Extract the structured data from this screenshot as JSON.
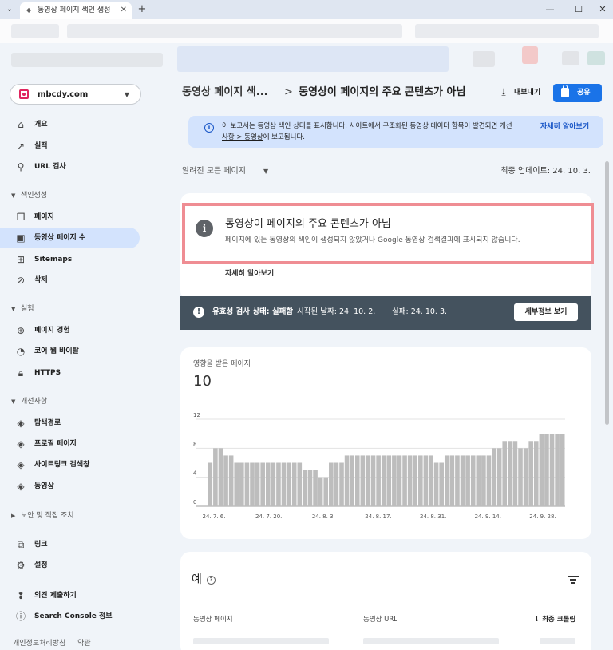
{
  "browser": {
    "tab_title": "동영상 페이지 색인 생성",
    "tab_close": "✕",
    "new_tab": "+",
    "minimize": "—",
    "maximize": "☐",
    "close": "✕"
  },
  "sidebar": {
    "property": "mbcdy.com",
    "items_top": [
      {
        "label": "개요",
        "icon": "home-icon"
      },
      {
        "label": "실적",
        "icon": "trending-up-icon"
      },
      {
        "label": "URL 검사",
        "icon": "search-icon"
      }
    ],
    "sections": [
      {
        "title": "색인생성",
        "items": [
          {
            "label": "페이지",
            "icon": "pages-icon"
          },
          {
            "label": "동영상 페이지 수",
            "icon": "video-pages-icon",
            "active": true
          },
          {
            "label": "Sitemaps",
            "icon": "sitemap-icon"
          },
          {
            "label": "삭제",
            "icon": "removal-icon"
          }
        ]
      },
      {
        "title": "실험",
        "items": [
          {
            "label": "페이지 경험",
            "icon": "page-experience-icon"
          },
          {
            "label": "코어 웹 바이탈",
            "icon": "gauge-icon"
          },
          {
            "label": "HTTPS",
            "icon": "lock-icon"
          }
        ]
      },
      {
        "title": "개선사항",
        "items": [
          {
            "label": "탐색경로",
            "icon": "layers-icon"
          },
          {
            "label": "프로필 페이지",
            "icon": "layers-icon"
          },
          {
            "label": "사이트링크 검색창",
            "icon": "layers-icon"
          },
          {
            "label": "동영상",
            "icon": "layers-icon"
          }
        ]
      }
    ],
    "security_section": "보안 및 직접 조치",
    "items_bottom": [
      {
        "label": "링크",
        "icon": "links-icon"
      },
      {
        "label": "설정",
        "icon": "settings-icon"
      }
    ],
    "items_footer": [
      {
        "label": "의견 제출하기",
        "icon": "feedback-icon"
      },
      {
        "label": "Search Console 정보",
        "icon": "info-icon"
      }
    ],
    "footer": {
      "privacy": "개인정보처리방침",
      "terms": "약관"
    }
  },
  "header": {
    "breadcrumb": "동영상 페이지 색...",
    "separator": ">",
    "title": "동영상이 페이지의 주요 콘텐츠가 아님",
    "export_label": "내보내기",
    "share_label": "공유"
  },
  "banner": {
    "text_1": "이 보고서는 동영상 색인 상태를 표시합니다. 사이트에서 구조화된 동영상 데이터 항목이 발견되면 ",
    "link": "개선사항 > 동영상",
    "text_2": "에 보고됩니다.",
    "more": "자세히 알아보기"
  },
  "filter": {
    "label": "알려진 모든 페이지",
    "updated": "최종 업데이트: 24. 10. 3."
  },
  "issue": {
    "title": "동영상이 페이지의 주요 콘텐츠가 아님",
    "description": "페이지에 있는 동영상의 색인이 생성되지 않았거나 Google 동영상 검색결과에 표시되지 않습니다.",
    "more": "자세히 알아보기"
  },
  "validation": {
    "label": "유효성 검사 상태: 실패함",
    "started": "시작된 날짜: 24. 10. 2.",
    "failed": "실패: 24. 10. 3.",
    "details_button": "세부정보 보기"
  },
  "affected": {
    "label": "영향을 받은 페이지",
    "value": "10"
  },
  "chart_data": {
    "type": "bar",
    "x_labels": [
      "24. 7. 6.",
      "24. 7. 20.",
      "24. 8. 3.",
      "24. 8. 17.",
      "24. 8. 31.",
      "24. 9. 14.",
      "24. 9. 28."
    ],
    "values": [
      6,
      8,
      8,
      7,
      7,
      6,
      6,
      6,
      6,
      6,
      6,
      6,
      6,
      6,
      6,
      6,
      6,
      6,
      5,
      5,
      5,
      4,
      4,
      6,
      6,
      6,
      7,
      7,
      7,
      7,
      7,
      7,
      7,
      7,
      7,
      7,
      7,
      7,
      7,
      7,
      7,
      7,
      7,
      6,
      6,
      7,
      7,
      7,
      7,
      7,
      7,
      7,
      7,
      7,
      8,
      8,
      9,
      9,
      9,
      8,
      8,
      9,
      9,
      10,
      10,
      10,
      10,
      10
    ],
    "yticks": [
      0,
      4,
      8,
      12
    ],
    "ylim": [
      0,
      12
    ],
    "bar_color": "#bdbdbd",
    "grid": true
  },
  "examples": {
    "title": "예",
    "help": "?",
    "col_page": "동영상 페이지",
    "col_url": "동영상 URL",
    "col_crawl": "최종 크롤링",
    "sort_arrow": "↓"
  },
  "colors": {
    "accent": "#1a73e8",
    "issue_border": "#ef8d93",
    "validation_bg": "#44525e"
  }
}
